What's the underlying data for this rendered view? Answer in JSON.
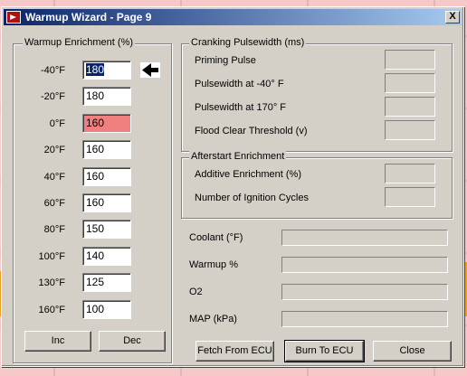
{
  "window": {
    "title": "Warmup Wizard - Page 9",
    "close_label": "X"
  },
  "warmup": {
    "label": "Warmup Enrichment (%)",
    "rows": [
      {
        "temp": "-40°F",
        "value": "180"
      },
      {
        "temp": "-20°F",
        "value": "180"
      },
      {
        "temp": "0°F",
        "value": "160"
      },
      {
        "temp": "20°F",
        "value": "160"
      },
      {
        "temp": "40°F",
        "value": "160"
      },
      {
        "temp": "60°F",
        "value": "160"
      },
      {
        "temp": "80°F",
        "value": "150"
      },
      {
        "temp": "100°F",
        "value": "140"
      },
      {
        "temp": "130°F",
        "value": "125"
      },
      {
        "temp": "160°F",
        "value": "100"
      }
    ],
    "highlight_color": "#f08080",
    "inc_label": "Inc",
    "dec_label": "Dec"
  },
  "cranking": {
    "label": "Cranking Pulsewidth (ms)",
    "items": [
      "Priming Pulse",
      "Pulsewidth at -40° F",
      "Pulsewidth at  170° F",
      "Flood Clear Threshold (v)"
    ]
  },
  "afterstart": {
    "label": "Afterstart Enrichment",
    "items": [
      "Additive Enrichment (%)",
      "Number of Ignition Cycles"
    ]
  },
  "status": {
    "items": [
      "Coolant (°F)",
      "Warmup %",
      "O2",
      "MAP (kPa)"
    ]
  },
  "buttons": {
    "fetch": "Fetch From ECU",
    "burn": "Burn To ECU",
    "close": "Close"
  },
  "icons": {
    "pointer": "left-arrow-icon"
  }
}
